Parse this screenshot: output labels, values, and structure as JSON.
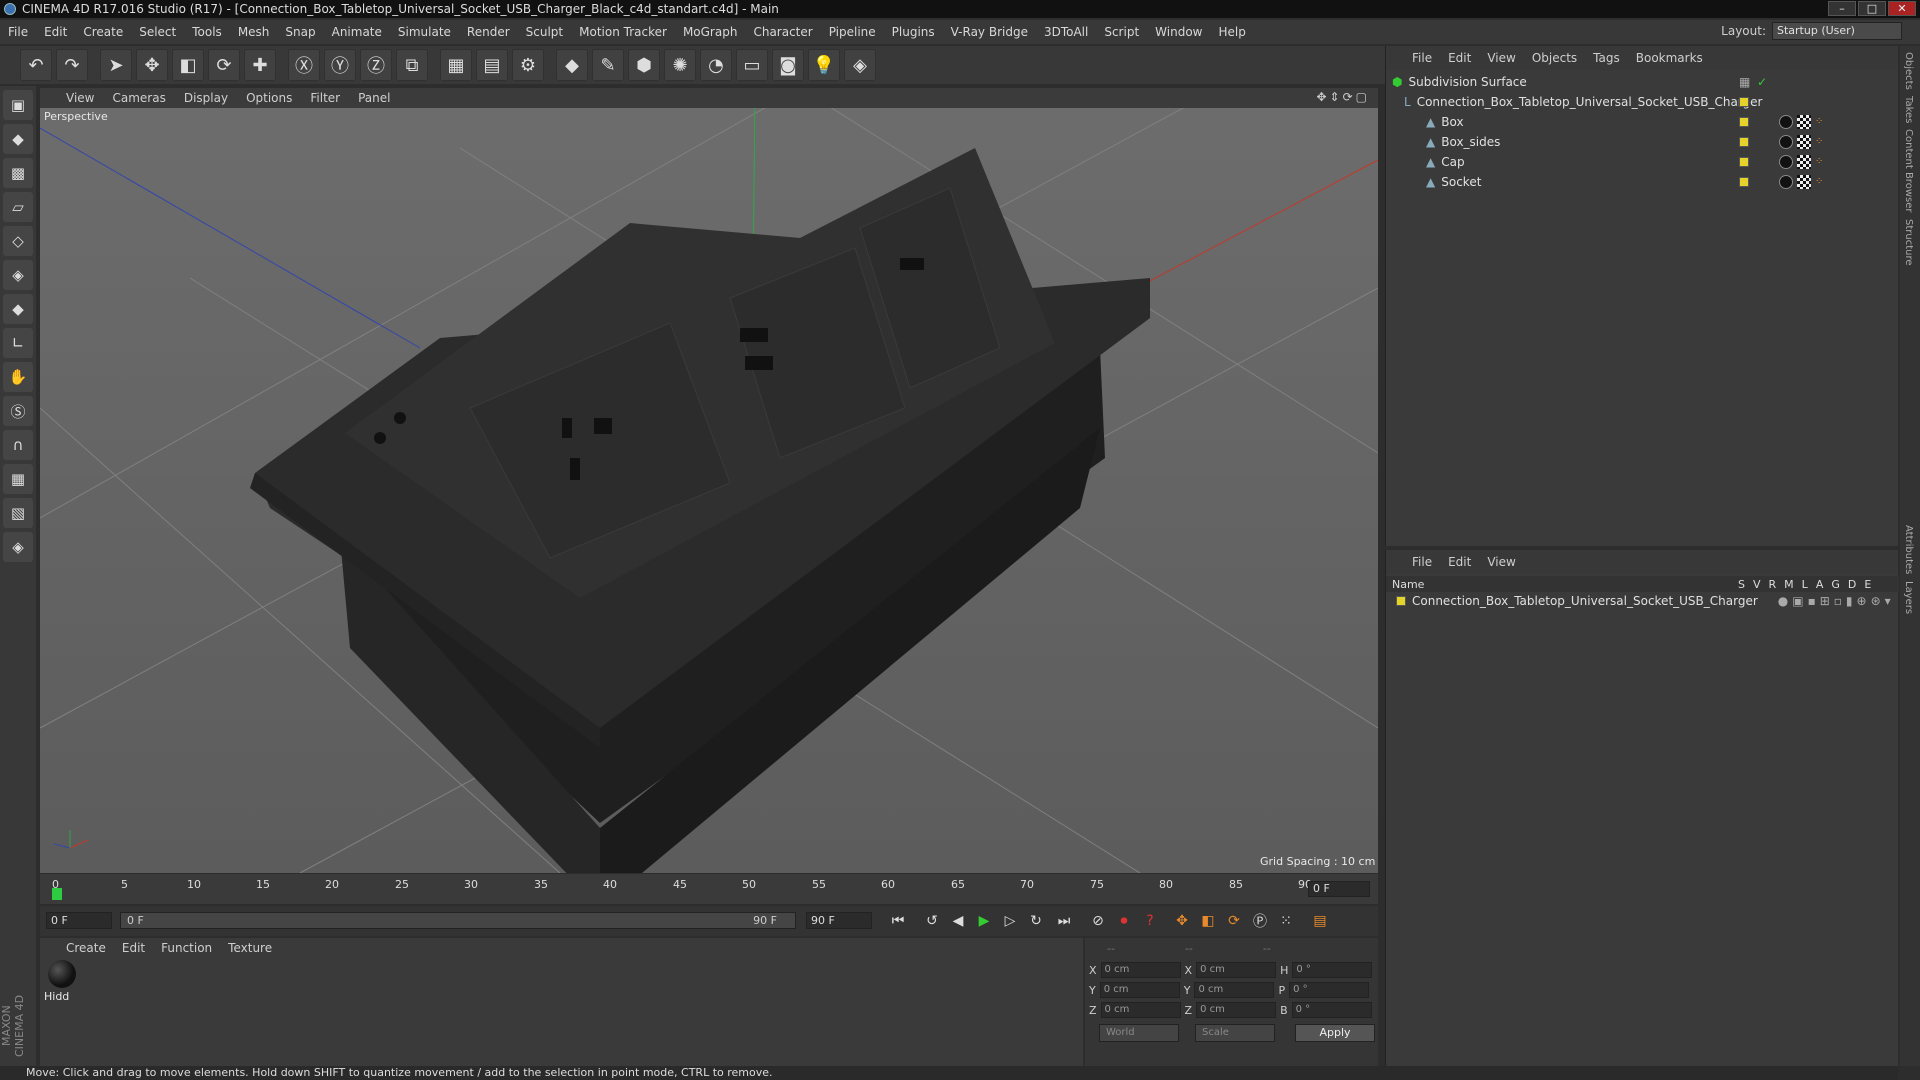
{
  "window": {
    "title": "CINEMA 4D R17.016 Studio (R17) - [Connection_Box_Tabletop_Universal_Socket_USB_Charger_Black_c4d_standart.c4d] - Main"
  },
  "menu": [
    "File",
    "Edit",
    "Create",
    "Select",
    "Tools",
    "Mesh",
    "Snap",
    "Animate",
    "Simulate",
    "Render",
    "Sculpt",
    "Motion Tracker",
    "MoGraph",
    "Character",
    "Pipeline",
    "Plugins",
    "V-Ray Bridge",
    "3DToAll",
    "Script",
    "Window",
    "Help"
  ],
  "layout": {
    "label": "Layout:",
    "value": "Startup (User)"
  },
  "viewport": {
    "menu": [
      "View",
      "Cameras",
      "Display",
      "Options",
      "Filter",
      "Panel"
    ],
    "camera": "Perspective",
    "grid_spacing": "Grid Spacing : 10 cm"
  },
  "timeline": {
    "ticks": [
      "0",
      "5",
      "10",
      "15",
      "20",
      "25",
      "30",
      "35",
      "40",
      "45",
      "50",
      "55",
      "60",
      "65",
      "70",
      "75",
      "80",
      "85",
      "90"
    ],
    "current_frame": "0 F",
    "start_frame": "0 F",
    "range_start": "0 F",
    "range_end": "90 F",
    "end_frame": "90 F"
  },
  "material_manager": {
    "menu": [
      "Create",
      "Edit",
      "Function",
      "Texture"
    ],
    "material_name": "Hidd"
  },
  "coordinates": {
    "headers": [
      "--",
      "--",
      "--"
    ],
    "x_pos": "0 cm",
    "y_pos": "0 cm",
    "z_pos": "0 cm",
    "x_size": "0 cm",
    "y_size": "0 cm",
    "z_size": "0 cm",
    "h_rot": "0 °",
    "p_rot": "0 °",
    "b_rot": "0 °",
    "mode": "World",
    "size_mode": "Scale",
    "apply": "Apply"
  },
  "status": "Move: Click and drag to move elements. Hold down SHIFT to quantize movement / add to the selection in point mode, CTRL to remove.",
  "brand": "MAXON CINEMA 4D",
  "object_manager": {
    "menu": [
      "File",
      "Edit",
      "View",
      "Objects",
      "Tags",
      "Bookmarks"
    ],
    "objects": [
      {
        "name": "Subdivision Surface"
      },
      {
        "name": "Connection_Box_Tabletop_Universal_Socket_USB_Charger"
      },
      {
        "name": "Box"
      },
      {
        "name": "Box_sides"
      },
      {
        "name": "Cap"
      },
      {
        "name": "Socket"
      }
    ]
  },
  "layer_manager": {
    "menu": [
      "File",
      "Edit",
      "View"
    ],
    "header_name": "Name",
    "columns": [
      "S",
      "V",
      "R",
      "M",
      "L",
      "A",
      "G",
      "D",
      "E"
    ],
    "layer": "Connection_Box_Tabletop_Universal_Socket_USB_Charger"
  },
  "side_tabs": [
    "Objects",
    "Takes",
    "Content Browser",
    "Structure",
    "Attributes",
    "Layers"
  ],
  "colors": {
    "accent_yellow": "#e4d42a",
    "viewport_bg": "#5b5b5b",
    "panel_bg": "#3a3a3a"
  }
}
